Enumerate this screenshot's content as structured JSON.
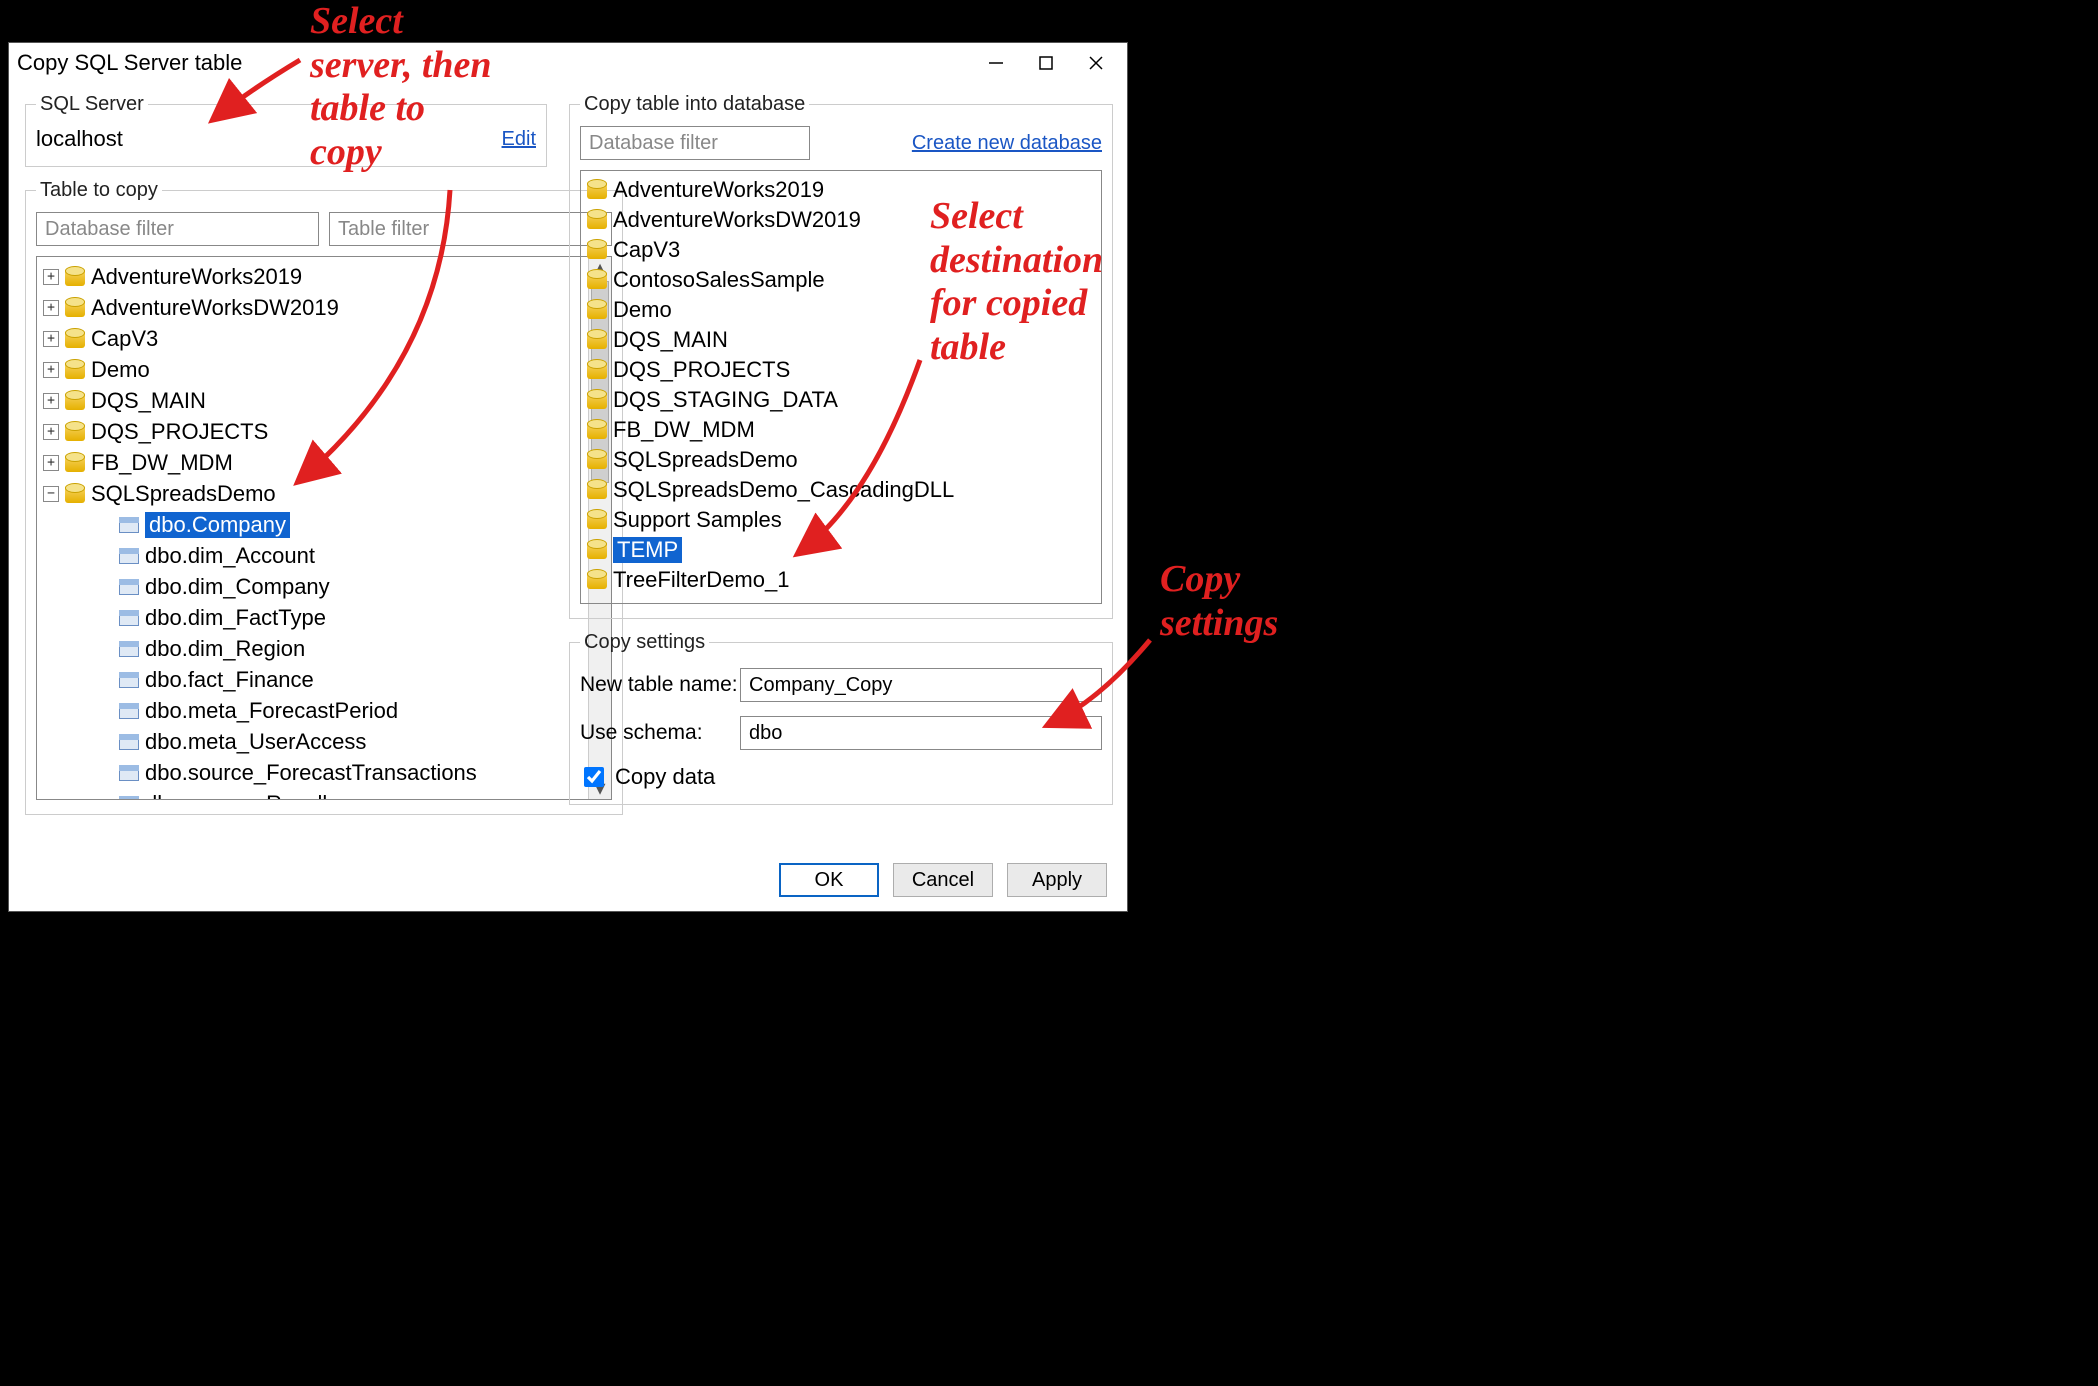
{
  "window": {
    "title": "Copy SQL Server table"
  },
  "sqlServer": {
    "legend": "SQL Server",
    "value": "localhost",
    "editLink": "Edit"
  },
  "sourceGroup": {
    "legend": "Table to copy",
    "dbFilterPlaceholder": "Database filter",
    "tblFilterPlaceholder": "Table filter"
  },
  "sourceTree": {
    "selectedPath": "SQLSpreadsDemo/dbo.Company",
    "nodes": [
      {
        "type": "db",
        "label": "AdventureWorks2019",
        "expanded": false,
        "depth": 0
      },
      {
        "type": "db",
        "label": "AdventureWorksDW2019",
        "expanded": false,
        "depth": 0
      },
      {
        "type": "db",
        "label": "CapV3",
        "expanded": false,
        "depth": 0
      },
      {
        "type": "db",
        "label": "Demo",
        "expanded": false,
        "depth": 0
      },
      {
        "type": "db",
        "label": "DQS_MAIN",
        "expanded": false,
        "depth": 0
      },
      {
        "type": "db",
        "label": "DQS_PROJECTS",
        "expanded": false,
        "depth": 0
      },
      {
        "type": "db",
        "label": "FB_DW_MDM",
        "expanded": false,
        "depth": 0
      },
      {
        "type": "db",
        "label": "SQLSpreadsDemo",
        "expanded": true,
        "depth": 0
      },
      {
        "type": "tbl",
        "label": "dbo.Company",
        "depth": 1,
        "selected": true
      },
      {
        "type": "tbl",
        "label": "dbo.dim_Account",
        "depth": 1
      },
      {
        "type": "tbl",
        "label": "dbo.dim_Company",
        "depth": 1
      },
      {
        "type": "tbl",
        "label": "dbo.dim_FactType",
        "depth": 1
      },
      {
        "type": "tbl",
        "label": "dbo.dim_Region",
        "depth": 1
      },
      {
        "type": "tbl",
        "label": "dbo.fact_Finance",
        "depth": 1
      },
      {
        "type": "tbl",
        "label": "dbo.meta_ForecastPeriod",
        "depth": 1
      },
      {
        "type": "tbl",
        "label": "dbo.meta_UserAccess",
        "depth": 1
      },
      {
        "type": "tbl",
        "label": "dbo.source_ForecastTransactions",
        "depth": 1
      },
      {
        "type": "tbl",
        "label": "dbo.source_Reseller",
        "depth": 1
      }
    ]
  },
  "destGroup": {
    "legend": "Copy table into database",
    "dbFilterPlaceholder": "Database filter",
    "createLink": "Create new database"
  },
  "destList": {
    "selected": "TEMP",
    "items": [
      "AdventureWorks2019",
      "AdventureWorksDW2019",
      "CapV3",
      "ContosoSalesSample",
      "Demo",
      "DQS_MAIN",
      "DQS_PROJECTS",
      "DQS_STAGING_DATA",
      "FB_DW_MDM",
      "SQLSpreadsDemo",
      "SQLSpreadsDemo_CascadingDLL",
      "Support Samples",
      "TEMP",
      "TreeFilterDemo_1"
    ]
  },
  "settings": {
    "legend": "Copy settings",
    "newNameLabel": "New table name:",
    "newNameValue": "Company_Copy",
    "schemaLabel": "Use schema:",
    "schemaValue": "dbo",
    "copyDataLabel": "Copy data",
    "copyDataChecked": true
  },
  "buttons": {
    "ok": "OK",
    "cancel": "Cancel",
    "apply": "Apply"
  },
  "annotations": {
    "a1": "Select\nserver, then\ntable to\ncopy",
    "a2": "Select\ndestination\nfor copied\ntable",
    "a3": "Copy\nsettings"
  }
}
